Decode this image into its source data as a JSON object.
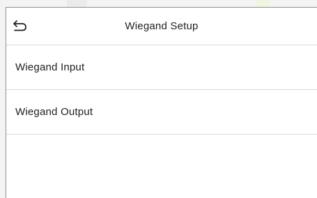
{
  "screen": {
    "title": "Wiegand Setup",
    "back_icon": "back-arrow-icon"
  },
  "menu": {
    "items": [
      {
        "label": "Wiegand Input"
      },
      {
        "label": "Wiegand Output"
      }
    ]
  }
}
